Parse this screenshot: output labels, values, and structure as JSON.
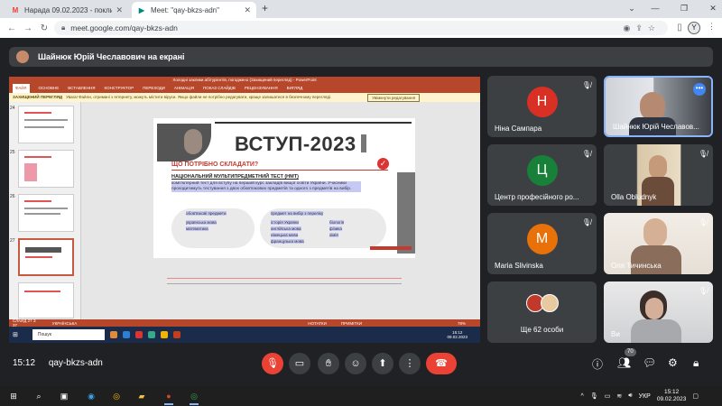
{
  "browser": {
    "tabs": [
      {
        "title": "Нарада 09.02.2023 - поклики...",
        "favicon": "gmail-icon",
        "active": false
      },
      {
        "title": "Meet: \"qay-bkzs-adn\"",
        "favicon": "meet-icon",
        "active": true
      }
    ],
    "new_tab": "+",
    "url": "meet.google.com/qay-bkzs-adn",
    "profile_initial": "Y"
  },
  "presenter_banner": "Шайнюк Юрій Чеславович на екрані",
  "shared_screen": {
    "ppt_title": "Холодні заклики абітурієнтів, погоджено (Захищений перегляд) - PowerPoint",
    "ppt_ribbon": [
      "ФАЙЛ",
      "ОСНОВНЕ",
      "ВСТАВЛЕННЯ",
      "КОНСТРУКТОР",
      "ПЕРЕХОДИ",
      "АНІМАЦІЯ",
      "ПОКАЗ СЛАЙДІВ",
      "РЕЦЕНЗУВАННЯ",
      "ВИГЛЯД"
    ],
    "protected_label": "ЗАХИЩЕНИЙ ПЕРЕГЛЯД",
    "protected_text": "Увага! Файли, отримані з Інтернету, можуть містити віруси. Якщо файли не потрібно редагувати, краще залишатися в безпечному перегляді.",
    "enable_editing": "Увімкнути редагування",
    "thumb_numbers": [
      "24",
      "25",
      "26",
      "27"
    ],
    "slide": {
      "title": "ВСТУП-2023",
      "question": "ЩО ПОТРІБНО СКЛАДАТИ?",
      "nmt_title": "НАЦІОНАЛЬНИЙ МУЛЬТИПРЕДМЕТНИЙ ТЕСТ (НМТ)",
      "description": "комп'ютерний тест для вступу на перший курс закладів вищої освіти України. Учасники проходитимуть тестування з двох обов'язкових предметів та одного з предметів на вибір.",
      "mandatory_heading": "обов'язкові предмети",
      "mandatory": [
        "українська мова",
        "математика"
      ],
      "elective_heading": "предмет на вибір з переліку",
      "elective_col1": [
        "історія України",
        "англійська мова",
        "німецька мова",
        "французька мова"
      ],
      "elective_col2": [
        "біологія",
        "фізика",
        "хімія"
      ]
    },
    "status": [
      "СЛАЙД 27 З 37",
      "УКРАЇНСЬКА",
      "НОТАТКИ",
      "ПРИМІТКИ",
      "78%"
    ],
    "inner_search": "Пошук",
    "inner_clock": [
      "15:12",
      "09.02.2023"
    ]
  },
  "participants": [
    {
      "name": "Ніна Сампара",
      "initial": "Н",
      "color": "#d93025",
      "muted": true,
      "video": false
    },
    {
      "name": "Шайнюк Юрій Чеславов...",
      "muted": false,
      "video": true,
      "pinned": true,
      "more_icon": "more-horiz-icon"
    },
    {
      "name": "Центр професійного ро...",
      "initial": "Ц",
      "color": "#188038",
      "muted": true,
      "video": false
    },
    {
      "name": "Olla Obludnyk",
      "muted": true,
      "video": true
    },
    {
      "name": "Maria Slivinska",
      "initial": "M",
      "color": "#e8710a",
      "muted": true,
      "video": false
    },
    {
      "name": "Оля Тичинська",
      "muted": true,
      "video": true
    },
    {
      "name": "Ще 62 особи",
      "muted": false,
      "video": false,
      "stack": true
    },
    {
      "name": "Ви",
      "muted": true,
      "video": true
    }
  ],
  "meeting": {
    "time": "15:12",
    "code": "qay-bkzs-adn",
    "people_count": "70"
  },
  "taskbar": {
    "language": "УКР",
    "time": "15:12",
    "date": "09.02.2023"
  }
}
